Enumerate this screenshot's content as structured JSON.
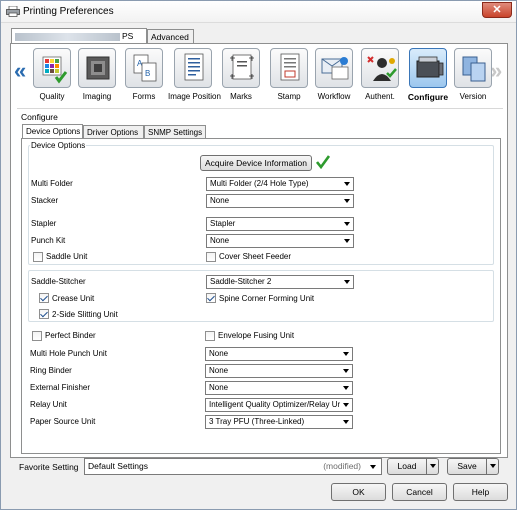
{
  "window": {
    "title": "Printing Preferences",
    "close_label": "✕"
  },
  "outer_tabs": {
    "printer_tab_suffix": "PS",
    "advanced": "Advanced"
  },
  "iconbar": {
    "items": [
      {
        "label": "Quality",
        "icon": "quality-icon"
      },
      {
        "label": "Imaging",
        "icon": "imaging-icon"
      },
      {
        "label": "Forms",
        "icon": "forms-icon"
      },
      {
        "label": "Image Position",
        "icon": "image-position-icon"
      },
      {
        "label": "Marks",
        "icon": "marks-icon"
      },
      {
        "label": "Stamp",
        "icon": "stamp-icon"
      },
      {
        "label": "Workflow",
        "icon": "workflow-icon"
      },
      {
        "label": "Authent.",
        "icon": "authentication-icon"
      },
      {
        "label": "Configure",
        "icon": "configure-icon",
        "selected": true
      },
      {
        "label": "Version",
        "icon": "version-icon"
      }
    ],
    "left_arrow": "«",
    "right_arrow": "»"
  },
  "configure": {
    "section_label": "Configure",
    "tabs": [
      "Device Options",
      "Driver Options",
      "SNMP Settings"
    ],
    "group_title": "Device Options",
    "acquire_button": "Acquire Device Information",
    "fields": {
      "multi_folder": {
        "label": "Multi Folder",
        "value": "Multi Folder (2/4 Hole Type)"
      },
      "stacker": {
        "label": "Stacker",
        "value": "None"
      },
      "stapler": {
        "label": "Stapler",
        "value": "Stapler"
      },
      "punch_kit": {
        "label": "Punch Kit",
        "value": "None"
      },
      "saddle_unit": {
        "label": "Saddle Unit",
        "checked": false
      },
      "cover_sheet_feeder": {
        "label": "Cover Sheet Feeder",
        "checked": false
      },
      "saddle_stitcher": {
        "label": "Saddle-Stitcher",
        "value": "Saddle-Stitcher 2"
      },
      "crease_unit": {
        "label": "Crease Unit",
        "checked": true
      },
      "spine_corner": {
        "label": "Spine Corner Forming Unit",
        "checked": true
      },
      "two_side_slitting": {
        "label": "2-Side Slitting Unit",
        "checked": true
      },
      "perfect_binder": {
        "label": "Perfect Binder",
        "checked": false
      },
      "envelope_fusing": {
        "label": "Envelope Fusing Unit",
        "checked": false
      },
      "multi_hole_punch": {
        "label": "Multi Hole Punch Unit",
        "value": "None"
      },
      "ring_binder": {
        "label": "Ring Binder",
        "value": "None"
      },
      "external_finisher": {
        "label": "External Finisher",
        "value": "None"
      },
      "relay_unit": {
        "label": "Relay Unit",
        "value": "Intelligent Quality Optimizer/Relay Ur"
      },
      "paper_source": {
        "label": "Paper Source Unit",
        "value": "3 Tray PFU (Three-Linked)"
      }
    }
  },
  "favorite": {
    "label": "Favorite Setting",
    "value": "Default Settings",
    "modified": "(modified)",
    "load": "Load",
    "save": "Save"
  },
  "footer": {
    "ok": "OK",
    "cancel": "Cancel",
    "help": "Help"
  },
  "colors": {
    "accent": "#3a76b8",
    "check_green": "#2e9b2e"
  }
}
